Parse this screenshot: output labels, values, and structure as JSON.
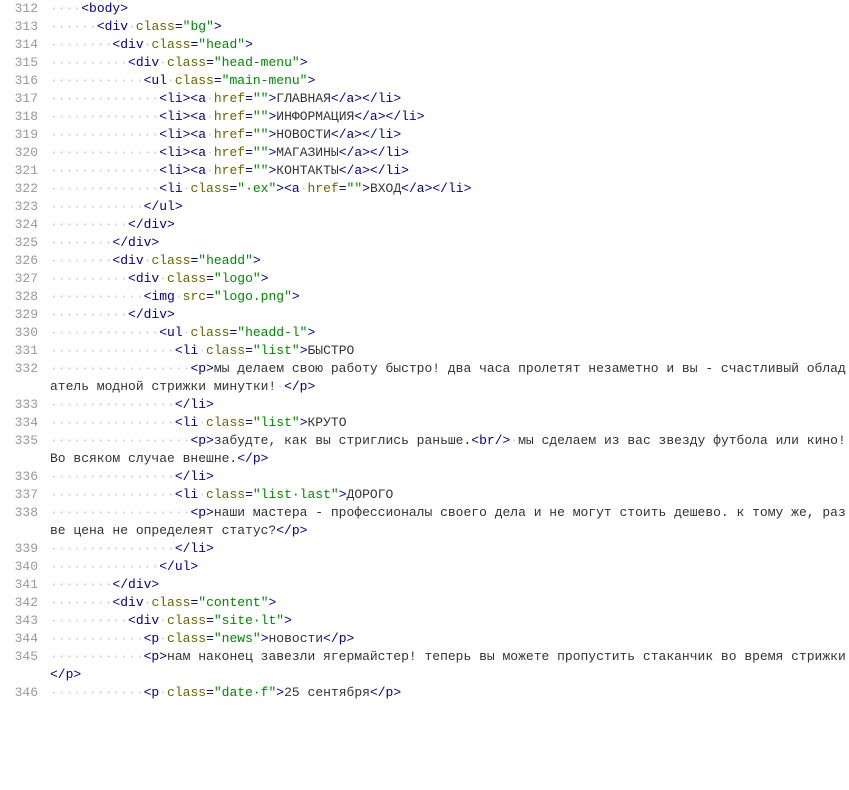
{
  "lines": [
    {
      "n": "312",
      "tokens": [
        [
          "ws",
          "····"
        ],
        [
          "tag",
          "<body>"
        ]
      ]
    },
    {
      "n": "313",
      "tokens": [
        [
          "ws",
          "······"
        ],
        [
          "tag",
          "<div"
        ],
        [
          "ws",
          "·"
        ],
        [
          "attr",
          "class"
        ],
        [
          "tag",
          "="
        ],
        [
          "str",
          "\"bg\""
        ],
        [
          "tag",
          ">"
        ]
      ]
    },
    {
      "n": "314",
      "tokens": [
        [
          "ws",
          "········"
        ],
        [
          "tag",
          "<div"
        ],
        [
          "ws",
          "·"
        ],
        [
          "attr",
          "class"
        ],
        [
          "tag",
          "="
        ],
        [
          "str",
          "\"head\""
        ],
        [
          "tag",
          ">"
        ]
      ]
    },
    {
      "n": "315",
      "tokens": [
        [
          "ws",
          "··········"
        ],
        [
          "tag",
          "<div"
        ],
        [
          "ws",
          "·"
        ],
        [
          "attr",
          "class"
        ],
        [
          "tag",
          "="
        ],
        [
          "str",
          "\"head-menu\""
        ],
        [
          "tag",
          ">"
        ]
      ]
    },
    {
      "n": "316",
      "tokens": [
        [
          "ws",
          "············"
        ],
        [
          "tag",
          "<ul"
        ],
        [
          "ws",
          "·"
        ],
        [
          "attr",
          "class"
        ],
        [
          "tag",
          "="
        ],
        [
          "str",
          "\"main-menu\""
        ],
        [
          "tag",
          ">"
        ]
      ]
    },
    {
      "n": "317",
      "tokens": [
        [
          "ws",
          "··············"
        ],
        [
          "tag",
          "<li><a"
        ],
        [
          "ws",
          "·"
        ],
        [
          "attr",
          "href"
        ],
        [
          "tag",
          "="
        ],
        [
          "str",
          "\"\""
        ],
        [
          "tag",
          ">"
        ],
        [
          "txt",
          "ГЛАВНАЯ"
        ],
        [
          "tag",
          "</a></li>"
        ]
      ]
    },
    {
      "n": "318",
      "tokens": [
        [
          "ws",
          "··············"
        ],
        [
          "tag",
          "<li><a"
        ],
        [
          "ws",
          "·"
        ],
        [
          "attr",
          "href"
        ],
        [
          "tag",
          "="
        ],
        [
          "str",
          "\"\""
        ],
        [
          "tag",
          ">"
        ],
        [
          "txt",
          "ИНФОРМАЦИЯ"
        ],
        [
          "tag",
          "</a></li>"
        ]
      ]
    },
    {
      "n": "319",
      "tokens": [
        [
          "ws",
          "··············"
        ],
        [
          "tag",
          "<li><a"
        ],
        [
          "ws",
          "·"
        ],
        [
          "attr",
          "href"
        ],
        [
          "tag",
          "="
        ],
        [
          "str",
          "\"\""
        ],
        [
          "tag",
          ">"
        ],
        [
          "txt",
          "НОВОСТИ"
        ],
        [
          "tag",
          "</a></li>"
        ]
      ]
    },
    {
      "n": "320",
      "tokens": [
        [
          "ws",
          "··············"
        ],
        [
          "tag",
          "<li><a"
        ],
        [
          "ws",
          "·"
        ],
        [
          "attr",
          "href"
        ],
        [
          "tag",
          "="
        ],
        [
          "str",
          "\"\""
        ],
        [
          "tag",
          ">"
        ],
        [
          "txt",
          "МАГАЗИНЫ"
        ],
        [
          "tag",
          "</a></li>"
        ]
      ]
    },
    {
      "n": "321",
      "tokens": [
        [
          "ws",
          "··············"
        ],
        [
          "tag",
          "<li><a"
        ],
        [
          "ws",
          "·"
        ],
        [
          "attr",
          "href"
        ],
        [
          "tag",
          "="
        ],
        [
          "str",
          "\"\""
        ],
        [
          "tag",
          ">"
        ],
        [
          "txt",
          "КОНТАКТЫ"
        ],
        [
          "tag",
          "</a></li>"
        ]
      ]
    },
    {
      "n": "322",
      "tokens": [
        [
          "ws",
          "··············"
        ],
        [
          "tag",
          "<li"
        ],
        [
          "ws",
          "·"
        ],
        [
          "attr",
          "class"
        ],
        [
          "tag",
          "="
        ],
        [
          "str",
          "\"·ex\""
        ],
        [
          "tag",
          "><a"
        ],
        [
          "ws",
          "·"
        ],
        [
          "attr",
          "href"
        ],
        [
          "tag",
          "="
        ],
        [
          "str",
          "\"\""
        ],
        [
          "tag",
          ">"
        ],
        [
          "txt",
          "ВХОД"
        ],
        [
          "tag",
          "</a></li>"
        ]
      ]
    },
    {
      "n": "323",
      "tokens": [
        [
          "ws",
          "············"
        ],
        [
          "tag",
          "</ul>"
        ]
      ]
    },
    {
      "n": "324",
      "tokens": [
        [
          "ws",
          "··········"
        ],
        [
          "tag",
          "</div>"
        ]
      ]
    },
    {
      "n": "325",
      "tokens": [
        [
          "ws",
          "········"
        ],
        [
          "tag",
          "</div>"
        ]
      ]
    },
    {
      "n": "326",
      "tokens": [
        [
          "ws",
          "········"
        ],
        [
          "tag",
          "<div"
        ],
        [
          "ws",
          "·"
        ],
        [
          "attr",
          "class"
        ],
        [
          "tag",
          "="
        ],
        [
          "str",
          "\"headd\""
        ],
        [
          "tag",
          ">"
        ]
      ]
    },
    {
      "n": "327",
      "tokens": [
        [
          "ws",
          "··········"
        ],
        [
          "tag",
          "<div"
        ],
        [
          "ws",
          "·"
        ],
        [
          "attr",
          "class"
        ],
        [
          "tag",
          "="
        ],
        [
          "str",
          "\"logo\""
        ],
        [
          "tag",
          ">"
        ]
      ]
    },
    {
      "n": "328",
      "tokens": [
        [
          "ws",
          "············"
        ],
        [
          "tag",
          "<img"
        ],
        [
          "ws",
          "·"
        ],
        [
          "attr",
          "src"
        ],
        [
          "tag",
          "="
        ],
        [
          "str",
          "\"logo.png\""
        ],
        [
          "tag",
          ">"
        ]
      ]
    },
    {
      "n": "329",
      "tokens": [
        [
          "ws",
          "··········"
        ],
        [
          "tag",
          "</div>"
        ]
      ]
    },
    {
      "n": "330",
      "tokens": [
        [
          "ws",
          "··············"
        ],
        [
          "tag",
          "<ul"
        ],
        [
          "ws",
          "·"
        ],
        [
          "attr",
          "class"
        ],
        [
          "tag",
          "="
        ],
        [
          "str",
          "\"headd-l\""
        ],
        [
          "tag",
          ">"
        ]
      ]
    },
    {
      "n": "331",
      "tokens": [
        [
          "ws",
          "················"
        ],
        [
          "tag",
          "<li"
        ],
        [
          "ws",
          "·"
        ],
        [
          "attr",
          "class"
        ],
        [
          "tag",
          "="
        ],
        [
          "str",
          "\"list\""
        ],
        [
          "tag",
          ">"
        ],
        [
          "txt",
          "БЫСТРО"
        ]
      ]
    },
    {
      "n": "332",
      "tokens": [
        [
          "ws",
          "··················"
        ],
        [
          "tag",
          "<p>"
        ],
        [
          "txt",
          "мы делаем свою работу быстро! два часа пролетят незаметно и вы - счастливый обладатель модной стрижки минутки!"
        ],
        [
          "ws",
          "·"
        ],
        [
          "tag",
          "</p>"
        ]
      ],
      "wrap": true
    },
    {
      "n": "333",
      "tokens": [
        [
          "ws",
          "················"
        ],
        [
          "tag",
          "</li>"
        ]
      ]
    },
    {
      "n": "334",
      "tokens": [
        [
          "ws",
          "················"
        ],
        [
          "tag",
          "<li"
        ],
        [
          "ws",
          "·"
        ],
        [
          "attr",
          "class"
        ],
        [
          "tag",
          "="
        ],
        [
          "str",
          "\"list\""
        ],
        [
          "tag",
          ">"
        ],
        [
          "txt",
          "КРУТО"
        ]
      ]
    },
    {
      "n": "335",
      "tokens": [
        [
          "ws",
          "··················"
        ],
        [
          "tag",
          "<p>"
        ],
        [
          "txt",
          "забудте, как вы стриглись раньше."
        ],
        [
          "tag",
          "<br/>"
        ],
        [
          "ws",
          "·"
        ],
        [
          "txt",
          "мы сделаем из вас звезду футбола или кино! Во всяком случае внешне."
        ],
        [
          "tag",
          "</p>"
        ]
      ],
      "wrap": true
    },
    {
      "n": "336",
      "tokens": [
        [
          "ws",
          "················"
        ],
        [
          "tag",
          "</li>"
        ]
      ]
    },
    {
      "n": "337",
      "tokens": [
        [
          "ws",
          "················"
        ],
        [
          "tag",
          "<li"
        ],
        [
          "ws",
          "·"
        ],
        [
          "attr",
          "class"
        ],
        [
          "tag",
          "="
        ],
        [
          "str",
          "\"list·last\""
        ],
        [
          "tag",
          ">"
        ],
        [
          "txt",
          "ДОРОГО"
        ]
      ]
    },
    {
      "n": "338",
      "tokens": [
        [
          "ws",
          "··················"
        ],
        [
          "tag",
          "<p>"
        ],
        [
          "txt",
          "наши мастера - профессионалы своего дела и не могут стоить дешево. к тому же, разве цена не определеят статус?"
        ],
        [
          "tag",
          "</p>"
        ]
      ],
      "wrap": true
    },
    {
      "n": "339",
      "tokens": [
        [
          "ws",
          "················"
        ],
        [
          "tag",
          "</li>"
        ]
      ]
    },
    {
      "n": "340",
      "tokens": [
        [
          "ws",
          "··············"
        ],
        [
          "tag",
          "</ul>"
        ]
      ]
    },
    {
      "n": "341",
      "tokens": [
        [
          "ws",
          "········"
        ],
        [
          "tag",
          "</div>"
        ]
      ]
    },
    {
      "n": "342",
      "tokens": [
        [
          "ws",
          "········"
        ],
        [
          "tag",
          "<div"
        ],
        [
          "ws",
          "·"
        ],
        [
          "attr",
          "class"
        ],
        [
          "tag",
          "="
        ],
        [
          "str",
          "\"content\""
        ],
        [
          "tag",
          ">"
        ]
      ]
    },
    {
      "n": "343",
      "tokens": [
        [
          "ws",
          "··········"
        ],
        [
          "tag",
          "<div"
        ],
        [
          "ws",
          "·"
        ],
        [
          "attr",
          "class"
        ],
        [
          "tag",
          "="
        ],
        [
          "str",
          "\"site·lt\""
        ],
        [
          "tag",
          ">"
        ]
      ]
    },
    {
      "n": "344",
      "tokens": [
        [
          "ws",
          "············"
        ],
        [
          "tag",
          "<p"
        ],
        [
          "ws",
          "·"
        ],
        [
          "attr",
          "class"
        ],
        [
          "tag",
          "="
        ],
        [
          "str",
          "\"news\""
        ],
        [
          "tag",
          ">"
        ],
        [
          "txt",
          "новости"
        ],
        [
          "tag",
          "</p>"
        ]
      ]
    },
    {
      "n": "345",
      "tokens": [
        [
          "ws",
          "············"
        ],
        [
          "tag",
          "<p>"
        ],
        [
          "txt",
          "нам наконец завезли ягермайстер! теперь вы можете пропустить стаканчик во время стрижки"
        ],
        [
          "tag",
          "</p>"
        ]
      ],
      "wrap": true
    },
    {
      "n": "346",
      "tokens": [
        [
          "ws",
          "············"
        ],
        [
          "tag",
          "<p"
        ],
        [
          "ws",
          "·"
        ],
        [
          "attr",
          "class"
        ],
        [
          "tag",
          "="
        ],
        [
          "str",
          "\"date·f\""
        ],
        [
          "tag",
          ">"
        ],
        [
          "txt",
          "25 сентября"
        ],
        [
          "tag",
          "</p>"
        ]
      ]
    }
  ]
}
